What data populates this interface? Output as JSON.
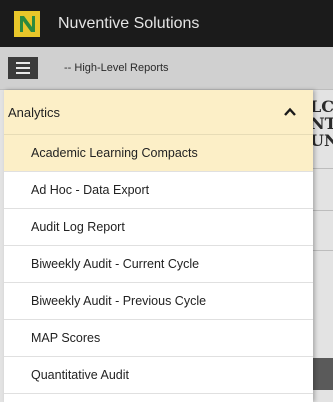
{
  "app": {
    "title": "Nuventive Solutions",
    "brand_color": "#1b1b1b",
    "logo_colors": [
      "#e8c62a",
      "#2b8a3e"
    ]
  },
  "subbar": {
    "menu_icon": "hamburger-icon",
    "breadcrumb": "-- High-Level Reports"
  },
  "background": {
    "title_fragment": "LC\nNT\nUN"
  },
  "drawer": {
    "section": {
      "label": "Analytics",
      "expanded": true,
      "toggle_icon": "chevron-up-icon"
    },
    "items": [
      {
        "label": "Academic Learning Compacts",
        "active": true
      },
      {
        "label": "Ad Hoc - Data Export",
        "active": false
      },
      {
        "label": "Audit Log Report",
        "active": false
      },
      {
        "label": "Biweekly Audit - Current Cycle",
        "active": false
      },
      {
        "label": "Biweekly Audit - Previous Cycle",
        "active": false
      },
      {
        "label": "MAP Scores",
        "active": false
      },
      {
        "label": "Quantitative Audit",
        "active": false
      }
    ],
    "highlight_color": "#fcefc7"
  }
}
